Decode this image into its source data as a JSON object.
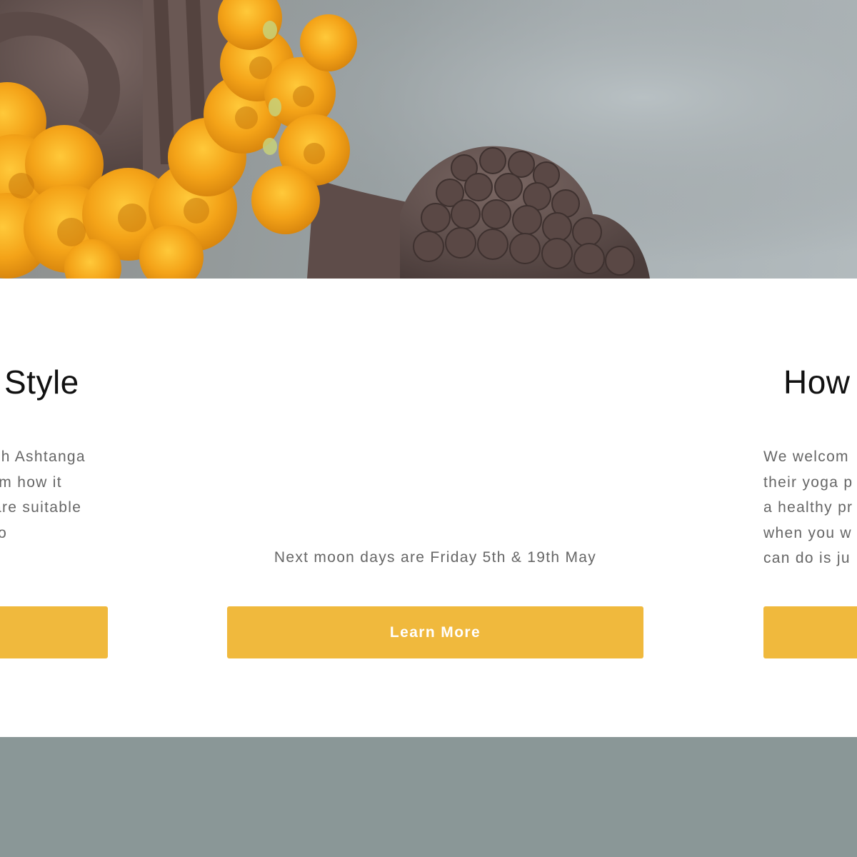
{
  "hero": {
    "image": "ganesha-statue-with-marigold-garland"
  },
  "columns": [
    {
      "title": "Style",
      "text_lines": [
        "ch Ashtanga",
        "rm how it",
        "are suitable",
        " to"
      ],
      "button_label": ""
    },
    {
      "title": "",
      "text_lines": [],
      "moon_days_text": "Next moon days are Friday 5th & 19th May",
      "button_label": "Learn More"
    },
    {
      "title": "How",
      "text_lines": [
        "We welcom",
        "their yoga p",
        "a healthy pr",
        "when you w",
        "can do is ju"
      ],
      "button_label": ""
    }
  ],
  "colors": {
    "accent": "#f0b93d",
    "footer_bg": "#8a9797",
    "body_text": "#666666",
    "heading_text": "#111111"
  }
}
